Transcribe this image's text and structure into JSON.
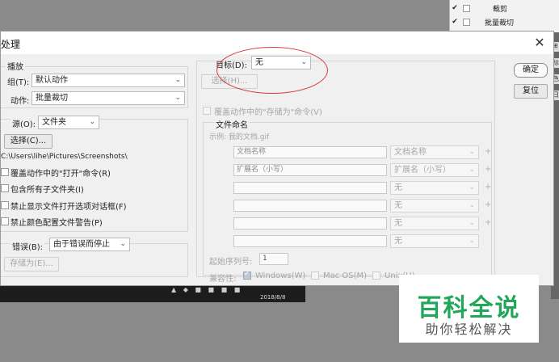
{
  "background_panel": {
    "rows": [
      {
        "checked": "✔",
        "arrow": "›",
        "label": "裁剪"
      },
      {
        "checked": "✔",
        "arrow": "⌄",
        "label": "批量裁切"
      }
    ],
    "strip_tabs": [
      "⊞",
      "标",
      "色",
      "日"
    ]
  },
  "taskbar": {
    "date": "2018/8/8",
    "icons": "▲ ◆ ■ ■ ■ ■"
  },
  "dialog": {
    "title": "处理",
    "play": {
      "section_label": "播放",
      "group_label": "组(T):",
      "group_value": "默认动作",
      "action_label": "动作:",
      "action_value": "批量裁切"
    },
    "source": {
      "label": "源(O):",
      "value": "文件夹",
      "choose_button": "选择(C)...",
      "path": "C:\\Users\\lihe\\Pictures\\Screenshots\\",
      "options": [
        "覆盖动作中的\"打开\"命令(R)",
        "包含所有子文件夹(I)",
        "禁止显示文件打开选项对话框(F)",
        "禁止颜色配置文件警告(P)"
      ]
    },
    "errors": {
      "label": "错误(B):",
      "value": "由于错误而停止",
      "save_as_button": "存储为(E)..."
    },
    "target": {
      "label": "目标(D):",
      "value": "无",
      "choose_button": "选择(H)...",
      "override_save": "覆盖动作中的\"存储为\"命令(V)"
    },
    "naming": {
      "section_label": "文件命名",
      "example": "示例: 我的文档.gif",
      "rows": [
        {
          "input": "文档名称",
          "select": "文档名称"
        },
        {
          "input": "扩展名（小写）",
          "select": "扩展名（小写）"
        },
        {
          "input": "",
          "select": "无"
        },
        {
          "input": "",
          "select": "无"
        },
        {
          "input": "",
          "select": "无"
        },
        {
          "input": "",
          "select": "无"
        }
      ],
      "plus": "+",
      "serial_label": "起始序列号:",
      "serial_value": "1",
      "compat_label": "兼容性:",
      "windows": "Windows(W)",
      "macos": "Mac OS(M)",
      "unix": "Unix(U)"
    },
    "buttons": {
      "ok": "确定",
      "reset": "复位"
    },
    "close_icon": "✕"
  },
  "watermark": {
    "title": "百科全说",
    "subtitle": "助你轻松解决"
  },
  "colors": {
    "annotation": "#d73a3a",
    "watermark_green": "#22a75a"
  },
  "icons": {
    "caret": "⌄"
  }
}
